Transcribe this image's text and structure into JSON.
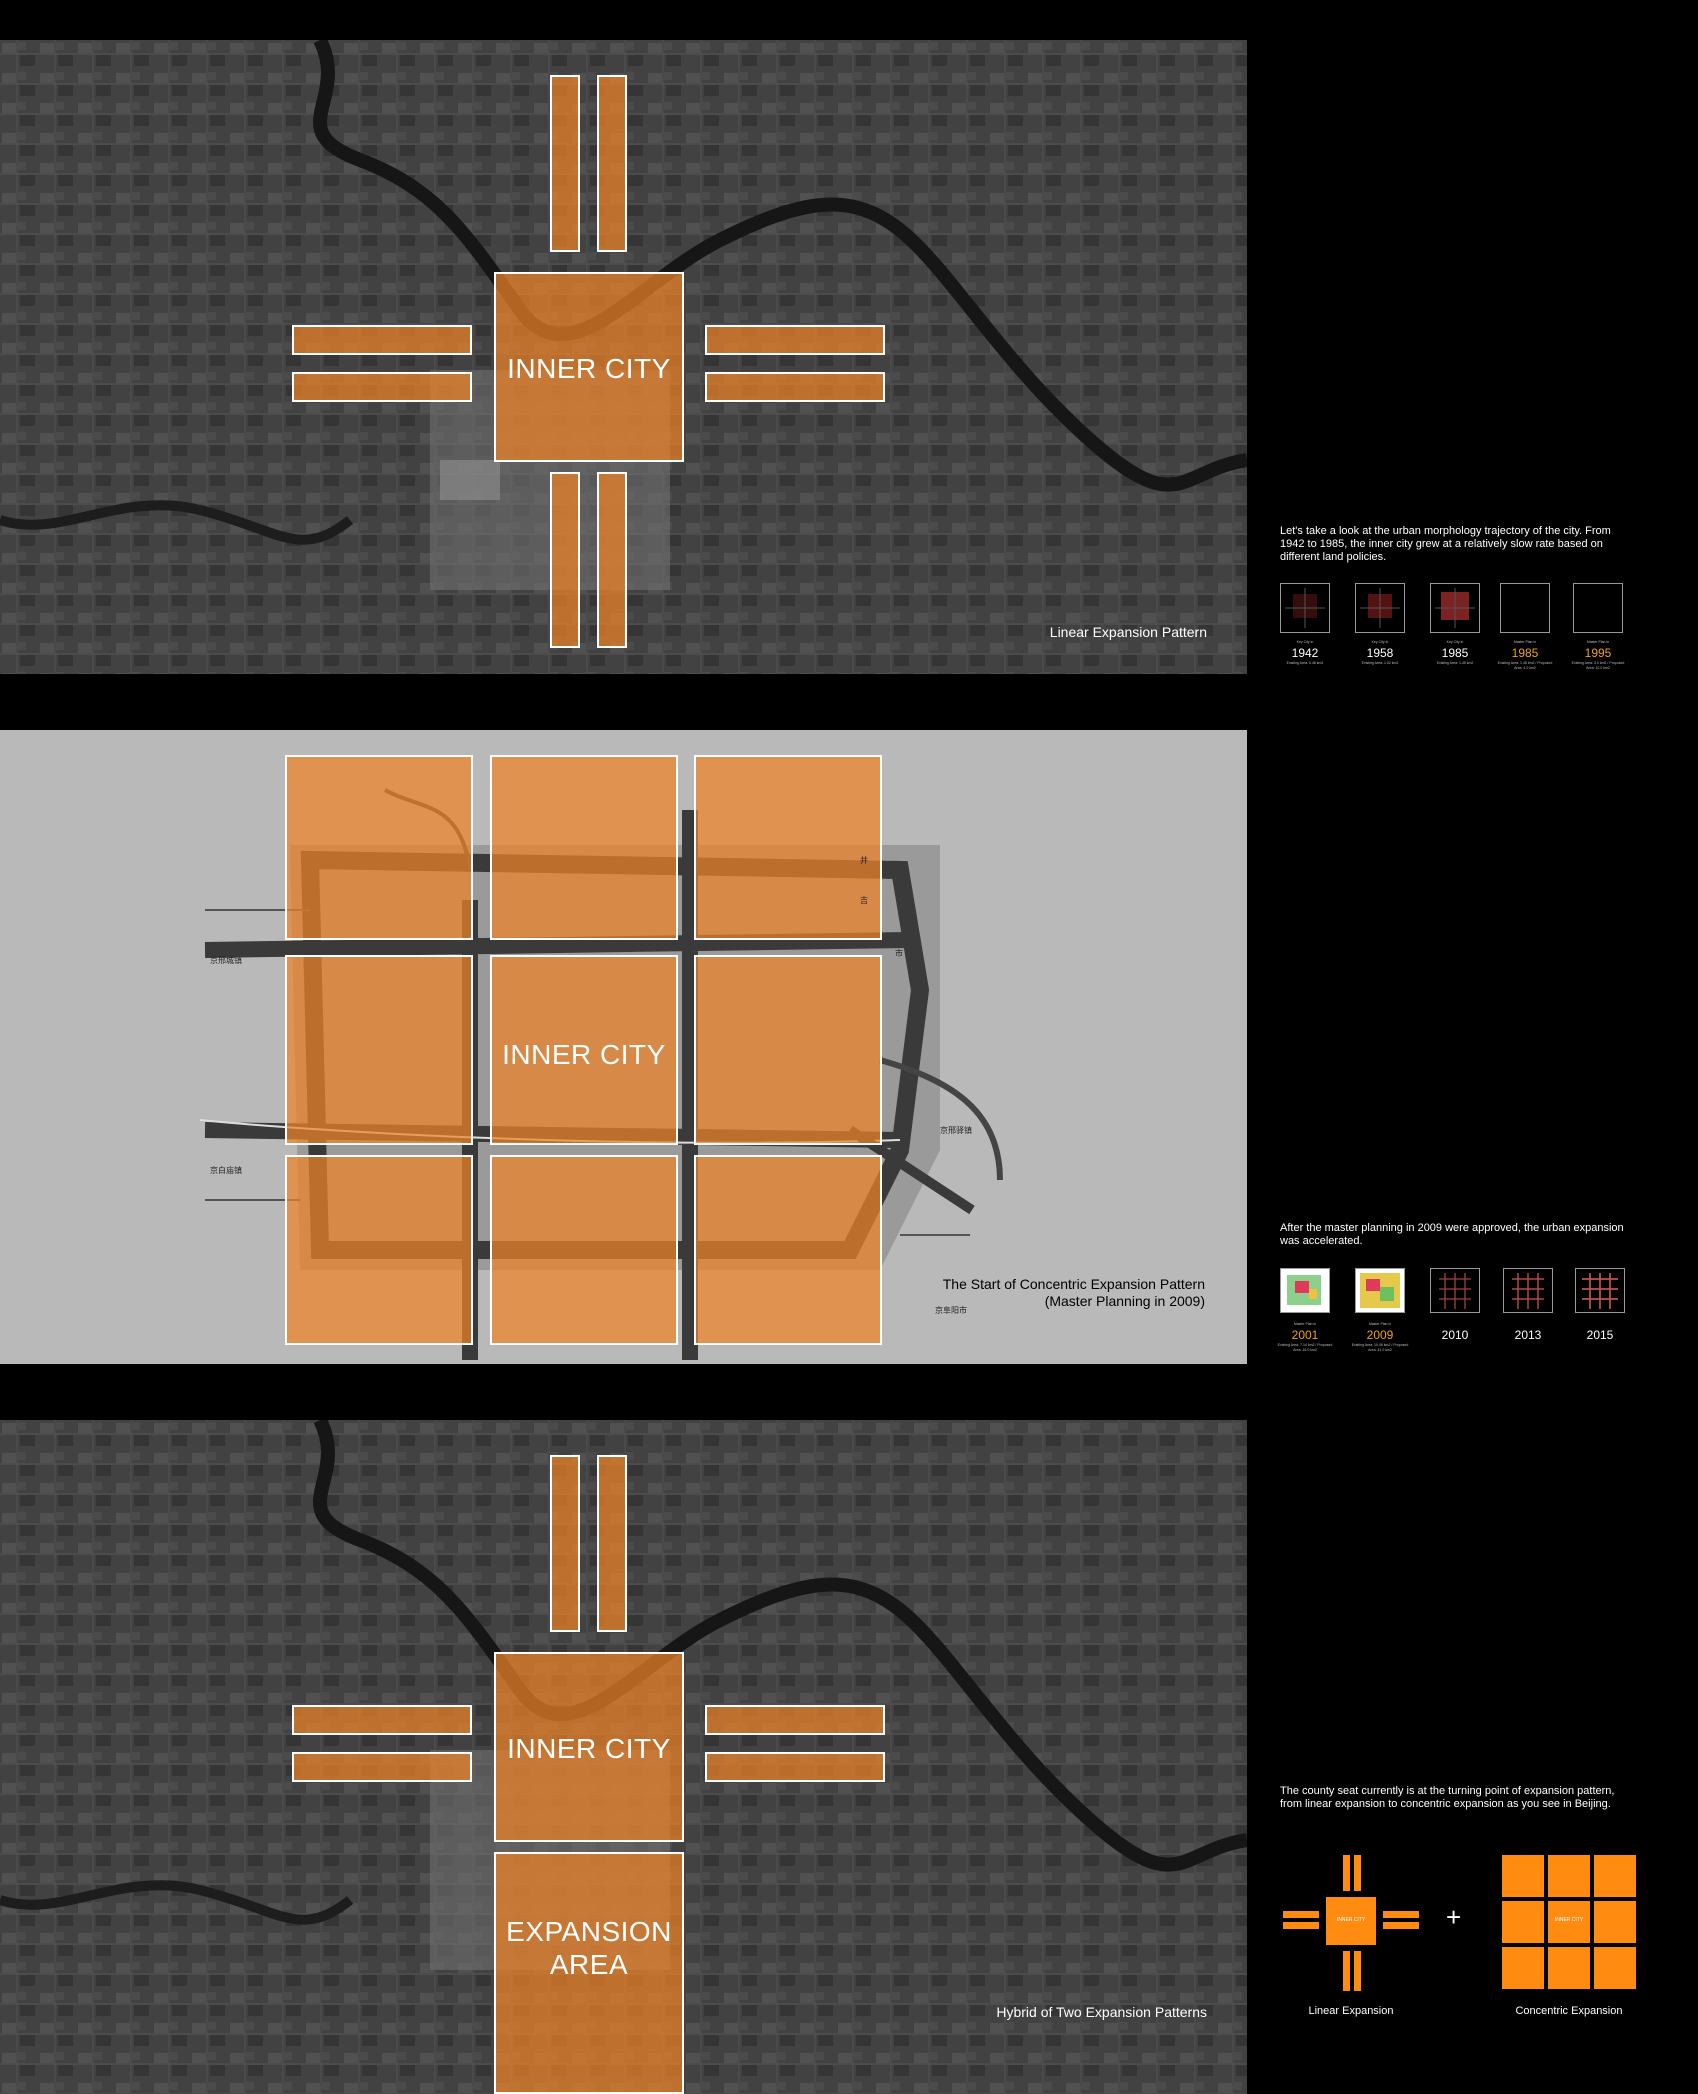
{
  "panels": {
    "linear": {
      "inner_city_label": "INNER CITY",
      "caption": "Linear Expansion Pattern"
    },
    "concentric": {
      "inner_city_label": "INNER CITY",
      "caption_line1": "The Start of Concentric Expansion Pattern",
      "caption_line2": "(Master Planning in 2009)",
      "map_labels": [
        "京邢城镇",
        "京白庙镇",
        "京邢驿镇",
        "京阜阳市",
        "井",
        "吉",
        "市"
      ]
    },
    "hybrid": {
      "inner_city_label": "INNER CITY",
      "expansion_label_line1": "EXPANSION",
      "expansion_label_line2": "AREA",
      "caption": "Hybrid of Two Expansion Patterns"
    }
  },
  "sidebar": {
    "section1": {
      "text": "Let's take a look at the urban morphology trajectory of the city. From 1942 to 1985, the inner city grew at a relatively slow rate based on different land policies.",
      "timeline": [
        {
          "sub": "Key City in",
          "year": "1942",
          "note": "Existing Area: 0.48 km2",
          "highlight": false
        },
        {
          "sub": "Key City in",
          "year": "1958",
          "note": "Existing Area: 1.02 km2",
          "highlight": false
        },
        {
          "sub": "Key City in",
          "year": "1985",
          "note": "Existing Area: 1.45 km2",
          "highlight": false
        },
        {
          "sub": "Master Plan in",
          "year": "1985",
          "note": "Existing Area: 1.45 km2 / Proposed Area: 4.0 km2",
          "highlight": true
        },
        {
          "sub": "Master Plan in",
          "year": "1995",
          "note": "Existing Area: 3.0 km2 / Proposed Area: 10.0 km2",
          "highlight": true
        }
      ]
    },
    "section2": {
      "text": "After the master planning in 2009 were approved, the urban expansion was accelerated.",
      "timeline": [
        {
          "sub": "Master Plan in",
          "year": "2001",
          "note": "Existing Area: 7.14 km2 / Proposed Area: 16.0 km2",
          "highlight": true
        },
        {
          "sub": "Master Plan in",
          "year": "2009",
          "note": "Existing Area: 10.46 km2 / Proposed Area: 41.0 km2",
          "highlight": true
        },
        {
          "sub": "",
          "year": "2010",
          "note": "",
          "highlight": false
        },
        {
          "sub": "",
          "year": "2013",
          "note": "",
          "highlight": false
        },
        {
          "sub": "",
          "year": "2015",
          "note": "",
          "highlight": false
        }
      ]
    },
    "section3": {
      "text": "The county seat currently is at the turning point of expansion pattern, from linear expansion to concentric expansion as you see in Beijing.",
      "plus": "+",
      "linear_icon_label": "INNER CITY",
      "concentric_icon_label": "INNER CITY",
      "linear_label": "Linear Expansion",
      "concentric_label": "Concentric Expansion"
    }
  },
  "colors": {
    "accent_orange": "#ee8228",
    "year_orange": "#f0a020",
    "background": "#000000",
    "map_gray": "#b9b9b9"
  }
}
